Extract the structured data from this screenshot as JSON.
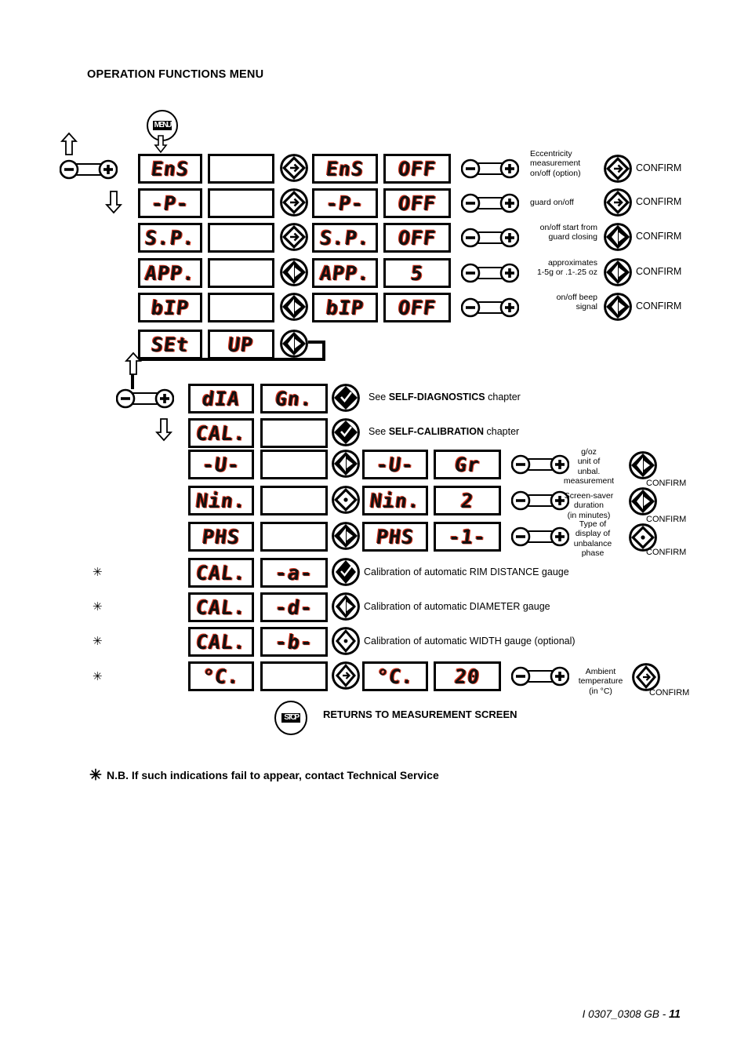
{
  "page": {
    "title": "OPERATION FUNCTIONS MENU",
    "nb_note": "N.B. If such indications fail to appear, contact  Technical Service",
    "nb_star": "✳",
    "footer_code": "I 0307_0308 GB - ",
    "footer_page": "11",
    "returns_label": "RETURNS TO MEASUREMENT SCREEN"
  },
  "buttons": {
    "menu": "MENU",
    "stop": "STOP",
    "confirm": "CONFIRM"
  },
  "section1": {
    "rows": [
      {
        "left_display": "EnS",
        "left_display2": "",
        "right_display": "EnS",
        "right_value": "OFF",
        "note": "Eccentricity\nmeasurement\non/off (option)",
        "note_lines": [
          "Eccentricity",
          "measurement",
          "on/off (option)"
        ],
        "confirm": "CONFIRM"
      },
      {
        "left_display": "-P-",
        "left_display2": "",
        "right_display": "-P-",
        "right_value": "OFF",
        "note_lines": [
          "guard on/off"
        ],
        "confirm": "CONFIRM"
      },
      {
        "left_display": "S.P.",
        "left_display2": "",
        "right_display": "S.P.",
        "right_value": "OFF",
        "note_lines": [
          "on/off start from",
          "guard closing"
        ],
        "confirm": "CONFIRM"
      },
      {
        "left_display": "APP.",
        "left_display2": "",
        "right_display": "APP.",
        "right_value": "5",
        "note_lines": [
          "approximates",
          "1-5g or .1-.25 oz"
        ],
        "confirm": "CONFIRM"
      },
      {
        "left_display": "bIP",
        "left_display2": "",
        "right_display": "bIP",
        "right_value": "OFF",
        "note_lines": [
          "on/off beep",
          "signal"
        ],
        "confirm": "CONFIRM"
      },
      {
        "left_display": "SEt",
        "left_display2": "UP",
        "right_display": "",
        "right_value": "",
        "note_lines": [],
        "confirm": ""
      }
    ]
  },
  "section2": {
    "rows": [
      {
        "left_display": "dIA",
        "left_display2": "Gn.",
        "right_display": "",
        "right_value": "",
        "chapter_prefix": "See ",
        "chapter_bold": "SELF-DIAGNOSTICS",
        "chapter_suffix": " chapter",
        "star": false
      },
      {
        "left_display": "CAL.",
        "left_display2": "",
        "right_display": "",
        "right_value": "",
        "chapter_prefix": "See ",
        "chapter_bold": "SELF-CALIBRATION",
        "chapter_suffix": " chapter",
        "star": false
      },
      {
        "left_display": "-U-",
        "left_display2": "",
        "right_display": "-U-",
        "right_value": "Gr",
        "note_lines": [
          "g/oz",
          "unit of",
          "unbal.",
          "measurement"
        ],
        "confirm": "CONFIRM",
        "star": false
      },
      {
        "left_display": "Nin.",
        "left_display2": "",
        "right_display": "Nin.",
        "right_value": "2",
        "note_lines": [
          "Screen-saver",
          "duration",
          "(in minutes)"
        ],
        "confirm": "CONFIRM",
        "star": false
      },
      {
        "left_display": "PHS",
        "left_display2": "",
        "right_display": "PHS",
        "right_value": "-1-",
        "note_lines": [
          "Type of",
          "display of",
          "unbalance",
          "phase"
        ],
        "confirm": "CONFIRM",
        "star": false
      },
      {
        "left_display": "CAL.",
        "left_display2": "-a-",
        "right_display": "",
        "right_value": "",
        "cal_note": "Calibration of automatic RIM DISTANCE gauge",
        "star": true
      },
      {
        "left_display": "CAL.",
        "left_display2": "-d-",
        "right_display": "",
        "right_value": "",
        "cal_note": "Calibration of automatic DIAMETER gauge",
        "star": true
      },
      {
        "left_display": "CAL.",
        "left_display2": "-b-",
        "right_display": "",
        "right_value": "",
        "cal_note": "Calibration of automatic  WIDTH  gauge (optional)",
        "star": true
      },
      {
        "left_display": "°C.",
        "left_display2": "",
        "right_display": "°C.",
        "right_value": "20",
        "note_lines": [
          "Ambient",
          "temperature",
          "(in °C)"
        ],
        "confirm": "CONFIRM",
        "star": true
      }
    ]
  },
  "icons": {
    "menu": "menu-icon",
    "stop": "stop-icon",
    "confirm": "confirm-arrow-icon",
    "plus": "plus-icon",
    "minus": "minus-icon",
    "arrow_up": "arrow-up-icon",
    "arrow_down": "arrow-down-icon"
  },
  "colors": {
    "ink": "#000000",
    "lcd_red": "#d8361f",
    "background": "#ffffff"
  }
}
